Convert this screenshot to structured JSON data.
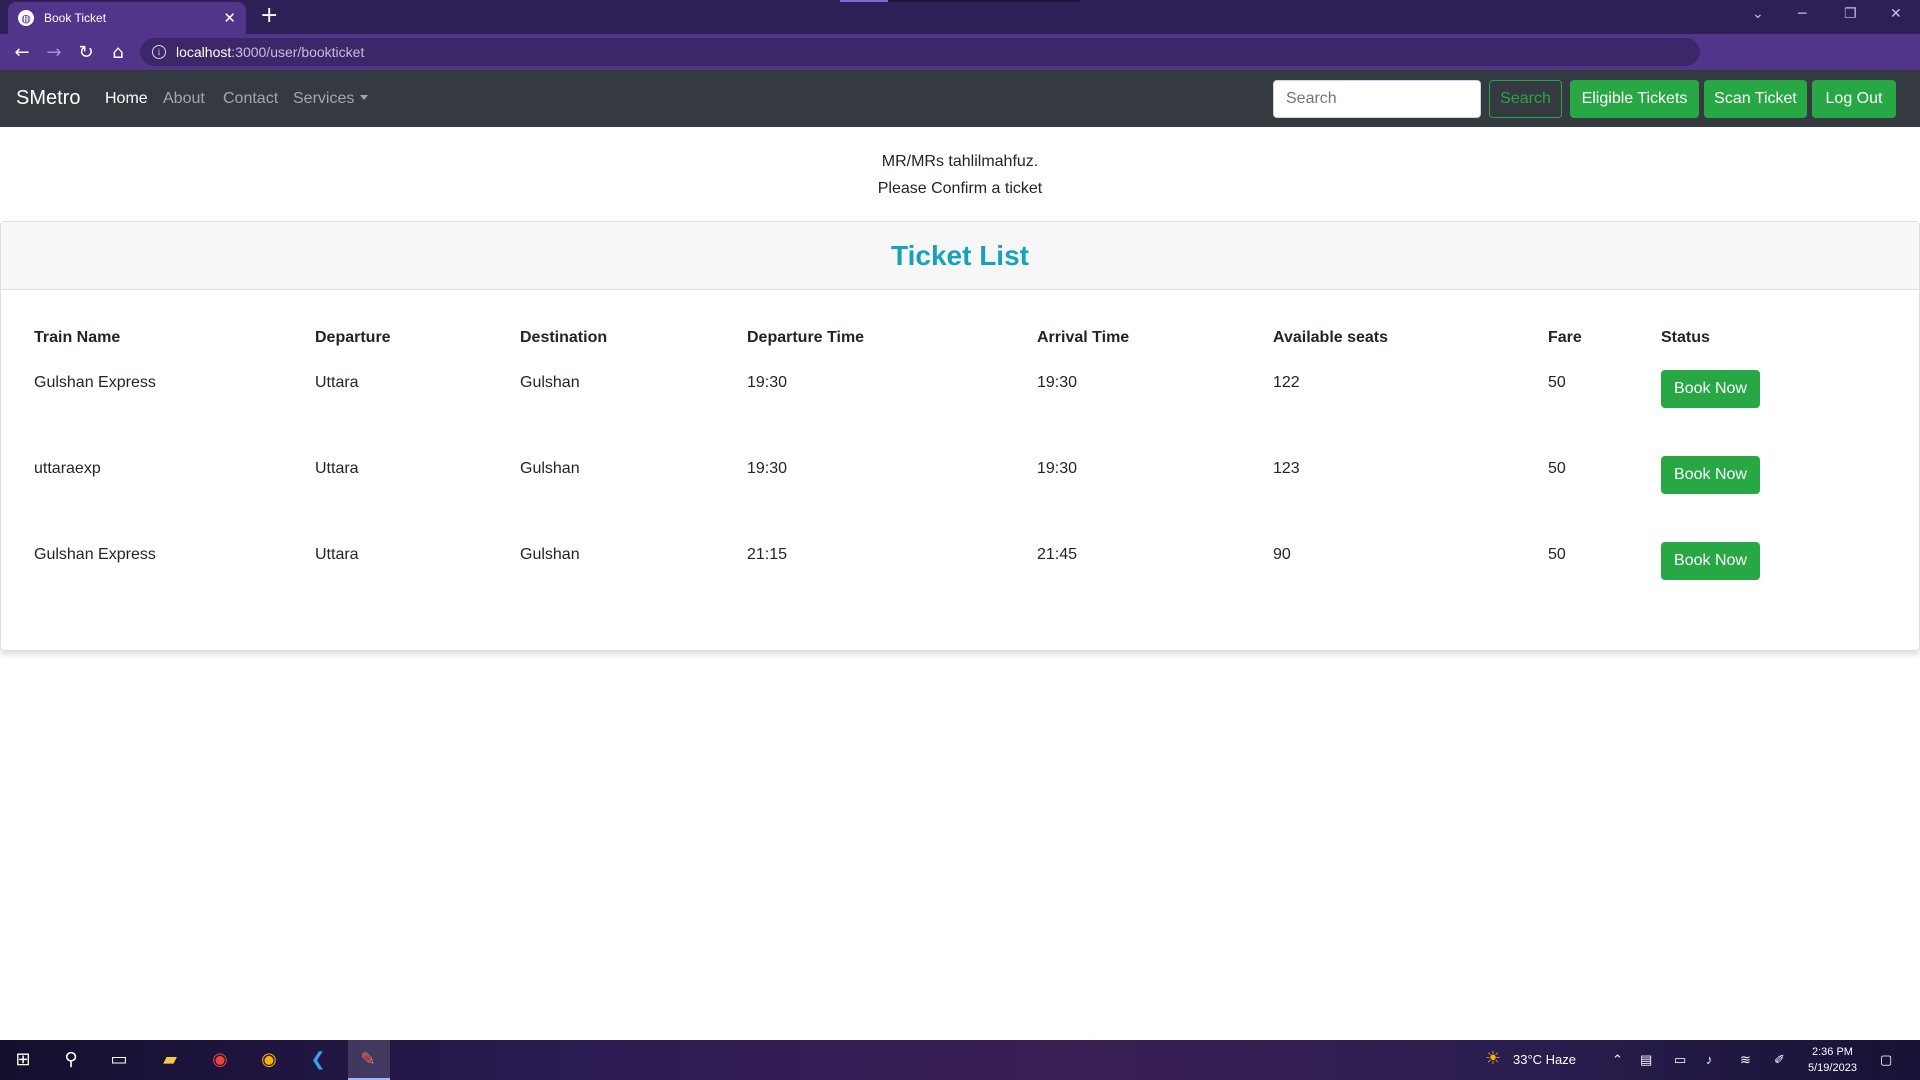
{
  "browser": {
    "tab_title": "Book Ticket",
    "url_host": "localhost",
    "url_rest": ":3000/user/bookticket"
  },
  "navbar": {
    "brand": "SMetro",
    "links": [
      "Home",
      "About",
      "Contact",
      "Services"
    ],
    "search_placeholder": "Search",
    "search_button": "Search",
    "buttons": [
      "Eligible Tickets",
      "Scan Ticket",
      "Log Out"
    ]
  },
  "greeting": {
    "line1": "MR/MRs tahlilmahfuz.",
    "line2": "Please Confirm a ticket"
  },
  "ticket_list": {
    "title": "Ticket List",
    "columns": [
      "Train Name",
      "Departure",
      "Destination",
      "Departure Time",
      "Arrival Time",
      "Available seats",
      "Fare",
      "Status"
    ],
    "rows": [
      {
        "train": "Gulshan Express",
        "departure": "Uttara",
        "destination": "Gulshan",
        "dep_time": "19:30",
        "arr_time": "19:30",
        "seats": "122",
        "fare": "50",
        "action": "Book Now"
      },
      {
        "train": "uttaraexp",
        "departure": "Uttara",
        "destination": "Gulshan",
        "dep_time": "19:30",
        "arr_time": "19:30",
        "seats": "123",
        "fare": "50",
        "action": "Book Now"
      },
      {
        "train": "Gulshan Express",
        "departure": "Uttara",
        "destination": "Gulshan",
        "dep_time": "21:15",
        "arr_time": "21:45",
        "seats": "90",
        "fare": "50",
        "action": "Book Now"
      }
    ]
  },
  "taskbar": {
    "weather": "33°C  Haze",
    "time": "2:36 PM",
    "date": "5/19/2023"
  },
  "colors": {
    "navbar_bg": "#343a40",
    "accent_green": "#28a745",
    "title_teal": "#17a2b8",
    "browser_purple": "#51358a"
  }
}
